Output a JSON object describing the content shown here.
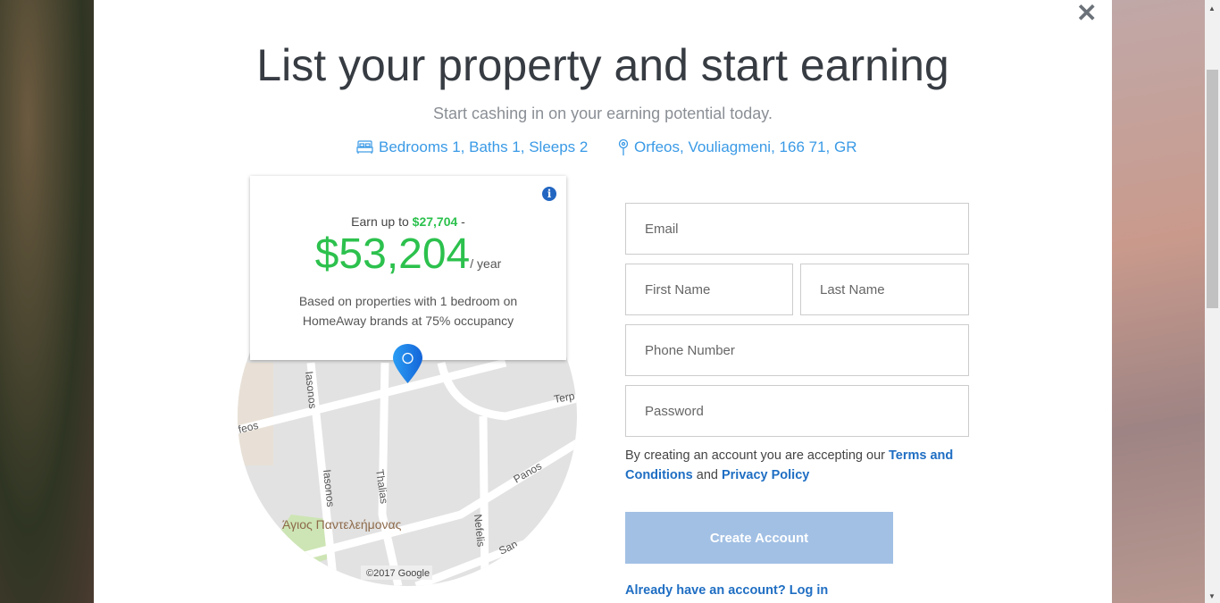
{
  "title": "List your property and start earning",
  "subtitle": "Start cashing in on your earning potential today.",
  "property": {
    "summary": "Bedrooms 1, Baths 1, Sleeps 2",
    "summary_icon": "bed-icon",
    "location": "Orfeos, Vouliagmeni, 166 71, GR",
    "location_icon": "map-pin-icon"
  },
  "estimate": {
    "prefix": "Earn up to",
    "low": "$27,704",
    "dash": "-",
    "high": "$53,204",
    "unit": "/ year",
    "basis": "Based on properties with 1 bedroom on HomeAway brands at 75% occupancy"
  },
  "map": {
    "streets": [
      "Iasonos",
      "Iasonos",
      "rfeos",
      "Thalias",
      "Terp",
      "Panos",
      "Nefelis",
      "Sap"
    ],
    "poi": "Άγιος Παντελεήμονας",
    "copyright": "©2017 Google"
  },
  "form": {
    "email": "Email",
    "first_name": "First Name",
    "last_name": "Last Name",
    "phone": "Phone Number",
    "password": "Password",
    "terms_prefix": "By creating an account you are accepting our",
    "terms_link": "Terms and Conditions",
    "and": "and",
    "privacy_link": "Privacy Policy",
    "submit": "Create Account",
    "login": "Already have an account? Log in"
  },
  "colors": {
    "accent": "#1f6ec3",
    "earn": "#2cc14d",
    "button_disabled": "#a2c0e4"
  }
}
